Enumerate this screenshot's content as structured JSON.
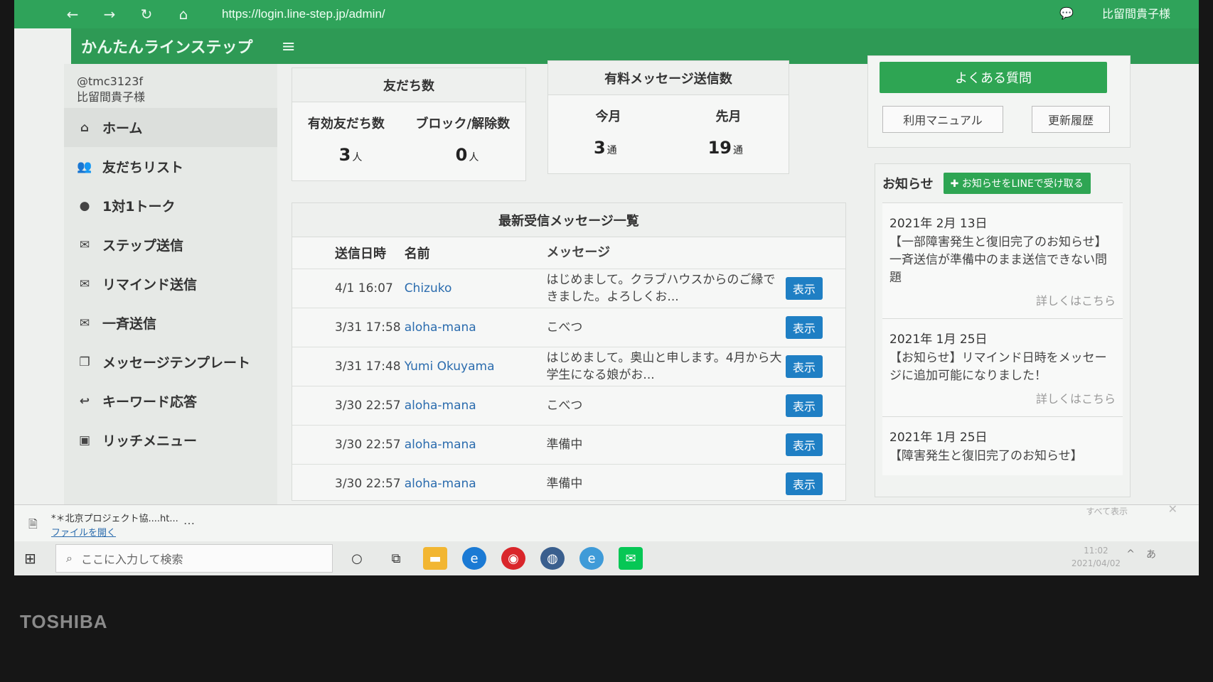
{
  "browser": {
    "url": "https://login.line-step.jp/admin/",
    "user": "比留間貴子様"
  },
  "app": {
    "title": "かんたんラインステップ"
  },
  "account": {
    "id": "@tmc3123f",
    "name": "比留間貴子様"
  },
  "sidebar": {
    "items": [
      {
        "label": "ホーム",
        "icon": "home-icon"
      },
      {
        "label": "友だちリスト",
        "icon": "users-icon"
      },
      {
        "label": "1対1トーク",
        "icon": "chat-icon"
      },
      {
        "label": "ステップ送信",
        "icon": "mail-icon"
      },
      {
        "label": "リマインド送信",
        "icon": "mail-icon"
      },
      {
        "label": "一斉送信",
        "icon": "mail-icon"
      },
      {
        "label": "メッセージテンプレート",
        "icon": "copy-icon"
      },
      {
        "label": "キーワード応答",
        "icon": "reply-icon"
      },
      {
        "label": "リッチメニュー",
        "icon": "image-icon"
      }
    ]
  },
  "friends": {
    "title": "友だち数",
    "active_label": "有効友だち数",
    "blocked_label": "ブロック/解除数",
    "active_value": "3",
    "blocked_value": "0",
    "unit": "人"
  },
  "paid": {
    "title": "有料メッセージ送信数",
    "this_month_label": "今月",
    "last_month_label": "先月",
    "this_month_value": "3",
    "last_month_value": "19",
    "unit": "通"
  },
  "messages": {
    "title": "最新受信メッセージ一覧",
    "headers": {
      "date": "送信日時",
      "name": "名前",
      "message": "メッセージ"
    },
    "button_label": "表示",
    "rows": [
      {
        "date": "4/1 16:07",
        "name": "Chizuko",
        "message": "はじめまして。クラブハウスからのご縁できました。よろしくお..."
      },
      {
        "date": "3/31 17:58",
        "name": "aloha-mana",
        "message": "こべつ"
      },
      {
        "date": "3/31 17:48",
        "name": "Yumi Okuyama",
        "message": "はじめまして。奥山と申します。4月から大学生になる娘がお..."
      },
      {
        "date": "3/30 22:57",
        "name": "aloha-mana",
        "message": "こべつ"
      },
      {
        "date": "3/30 22:57",
        "name": "aloha-mana",
        "message": "準備中"
      },
      {
        "date": "3/30 22:57",
        "name": "aloha-mana",
        "message": "準備中"
      }
    ]
  },
  "help": {
    "faq_label": "よくある質問",
    "manual_label": "利用マニュアル",
    "history_label": "更新履歴"
  },
  "news": {
    "title": "お知らせ",
    "line_button": "お知らせをLINEで受け取る",
    "more_label": "詳しくはこちら",
    "items": [
      {
        "date": "2021年 2月 13日",
        "text": "【一部障害発生と復旧完了のお知らせ】一斉送信が準備中のまま送信できない問題"
      },
      {
        "date": "2021年 1月 25日",
        "text": "【お知らせ】リマインド日時をメッセージに追加可能になりました！"
      },
      {
        "date": "2021年 1月 25日",
        "text": "【障害発生と復旧完了のお知らせ】"
      }
    ]
  },
  "download": {
    "filename": "*＊北京プロジェクト協....ht...",
    "open_label": "ファイルを開く",
    "show_all": "すべて表示"
  },
  "taskbar": {
    "search_placeholder": "ここに入力して検索",
    "time": "11:02",
    "date": "2021/04/02",
    "ime": "あ"
  },
  "device": {
    "brand": "TOSHIBA"
  }
}
